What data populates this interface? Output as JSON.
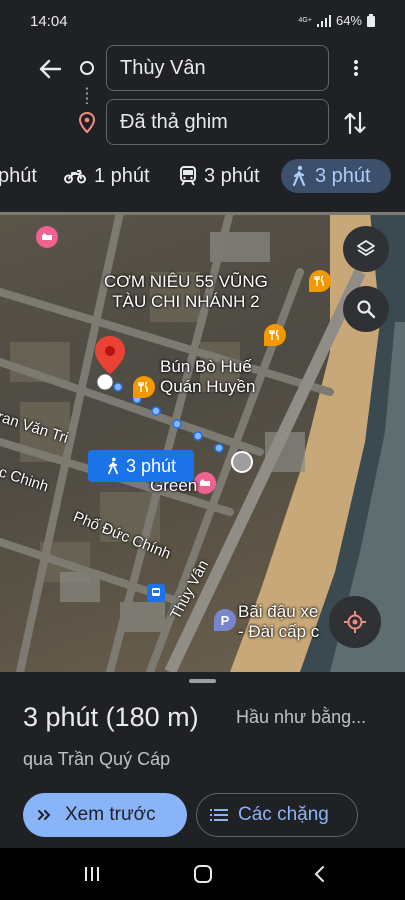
{
  "status": {
    "time": "14:04",
    "network": "4G+",
    "battery": "64%"
  },
  "route": {
    "start": "Thùy Vân",
    "destination": "Đã thả ghim"
  },
  "modes": [
    {
      "label": "phút",
      "icon": "car-icon"
    },
    {
      "label": "1 phút",
      "icon": "motorbike-icon"
    },
    {
      "label": "3 phút",
      "icon": "transit-icon"
    },
    {
      "label": "3 phút",
      "icon": "walk-icon",
      "selected": true
    }
  ],
  "map": {
    "labels": {
      "com_nieu_line1": "CƠM NIÊU 55 VŨNG",
      "com_nieu_line2": "TÀU CHI NHÁNH 2",
      "bun_bo_line1": "Bún Bò Huế",
      "bun_bo_line2": "Quán Huyền",
      "green": "Green",
      "van_tri": "ran Văn Tri",
      "c_chinh": "c Chinh",
      "pho_duc_chinh": "Phố Đức Chính",
      "thuy_van": "Thùy Vân",
      "parking_line1": "Bãi đậu xe",
      "parking_line2": "- Đài cấp c"
    },
    "route_chip": "3 phút",
    "route_color": "#8ab4f8"
  },
  "summary": {
    "time_distance": "3 phút (180 m)",
    "note": "Hầu như bằng...",
    "via": "qua Trần Quý Cáp"
  },
  "actions": {
    "preview": "Xem trước",
    "steps": "Các chặng"
  }
}
